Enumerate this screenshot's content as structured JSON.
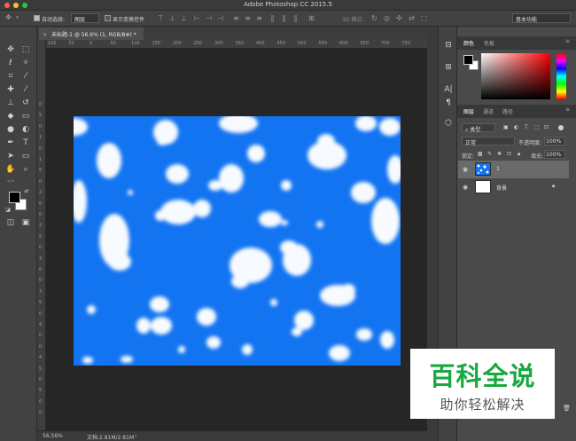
{
  "app": {
    "title": "Adobe Photoshop CC 2015.5"
  },
  "options_bar": {
    "auto_select_label": "自动选择:",
    "auto_select_value": "图层",
    "show_transform_label": "显示变换控件",
    "mode_3d_label": "3D 模式:",
    "workspace_value": "基本功能"
  },
  "document": {
    "tab_label": "未标题-1 @ 56.6% (1, RGB/8#) *",
    "ruler_top_labels": [
      "100",
      "50",
      "0",
      "50",
      "100",
      "150",
      "200",
      "250",
      "300",
      "350",
      "400",
      "450",
      "500",
      "550",
      "600",
      "650",
      "700",
      "750"
    ],
    "ruler_left_labels": [
      "0",
      "5",
      "0",
      "1",
      "0",
      "1",
      "5",
      "0",
      "2",
      "0",
      "0",
      "2",
      "5",
      "0",
      "3",
      "0",
      "0",
      "3",
      "5",
      "0",
      "4",
      "0",
      "0",
      "4",
      "5",
      "0",
      "5",
      "0",
      "0"
    ]
  },
  "status_bar": {
    "zoom": "56.56%",
    "doc_info": "文档:2.81M/2.81M"
  },
  "color_panel": {
    "tab_color": "颜色",
    "tab_swatches": "色板"
  },
  "layers_panel": {
    "tab_layers": "图层",
    "tab_channels": "通道",
    "tab_paths": "路径",
    "filter_kind": "类型",
    "blend_mode": "正常",
    "opacity_label": "不透明度:",
    "opacity_value": "100%",
    "lock_label": "锁定:",
    "fill_label": "填充:",
    "fill_value": "100%",
    "layers": [
      {
        "name": "1",
        "selected": true
      },
      {
        "name": "背景",
        "selected": false
      }
    ]
  },
  "watermark": {
    "line1": "百科全说",
    "line2": "助你轻松解决"
  },
  "colors": {
    "canvas_blue": "#1374f1",
    "watermark_green": "#17a940",
    "ui_dark": "#424242"
  }
}
